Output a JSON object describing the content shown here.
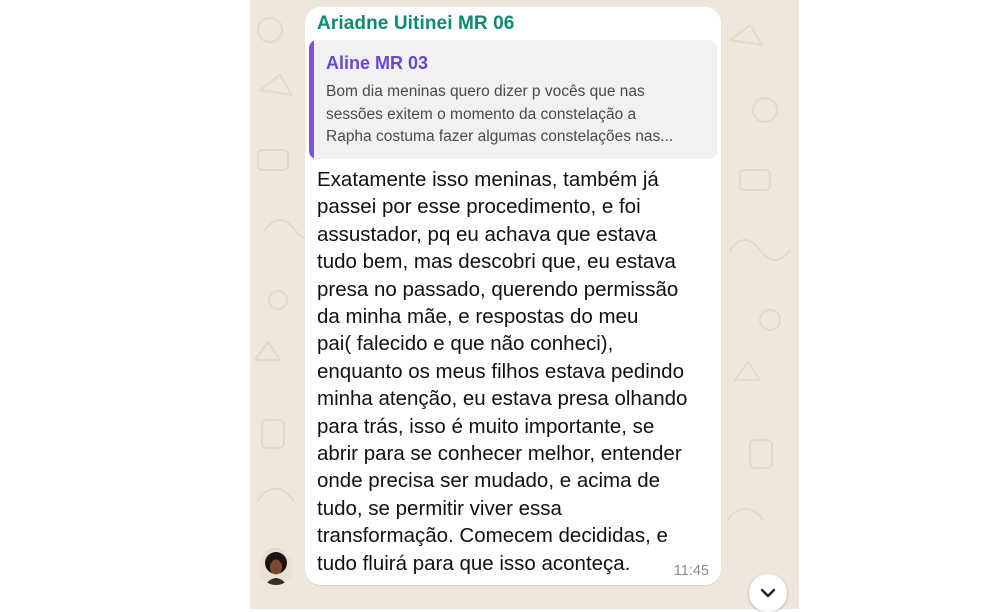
{
  "message": {
    "sender": "Ariadne Uitinei MR 06",
    "quoted": {
      "author": "Aline MR 03",
      "text": "Bom dia meninas quero dizer p vocês que nas\nsessões  exitem o momento da constelação a\nRapha costuma fazer algumas constelações nas..."
    },
    "text": "Exatamente isso meninas, também já\npassei por esse procedimento,  e foi\nassustador, pq eu achava que estava\ntudo bem, mas descobri que, eu estava\npresa no passado, querendo permissão\nda minha mãe,  e respostas do meu\npai( falecido e que não conheci),\nenquanto os meus filhos estava pedindo\nminha atenção,  eu estava presa olhando\npara trás,  isso é muito importante,  se\nabrir para se conhecer melhor, entender\nonde precisa ser mudado, e acima de\ntudo,  se permitir viver essa\ntransformação. Comecem decididas, e\ntudo fluirá para que isso aconteça.",
    "time": "11:45"
  },
  "icons": {
    "scroll_down": "chevron-down-icon",
    "avatar": "avatar"
  },
  "colors": {
    "sender_name": "#0b8a74",
    "quote_author": "#6a48c9",
    "quote_bar": "#7b55d6",
    "chat_background": "#efe7dc",
    "bubble": "#ffffff"
  }
}
